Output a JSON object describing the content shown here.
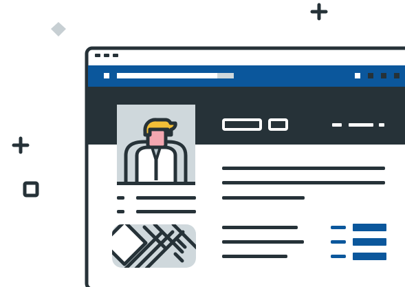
{
  "illustration": {
    "type": "profile-webpage-illustration",
    "colors": {
      "outline": "#263238",
      "dark_header": "#263238",
      "blue_bar": "#0b579c",
      "blue_accent": "#0b579c",
      "light_gray": "#cfd8dc",
      "decoration_gray": "#c7cfd3",
      "hair": "#f3bf37",
      "skin": "#f4a7b1",
      "white": "#ffffff"
    },
    "icons": [
      "plus-icon",
      "diamond-icon",
      "square-icon",
      "avatar-icon",
      "map-icon",
      "list-icon",
      "window-dots-icon"
    ]
  }
}
